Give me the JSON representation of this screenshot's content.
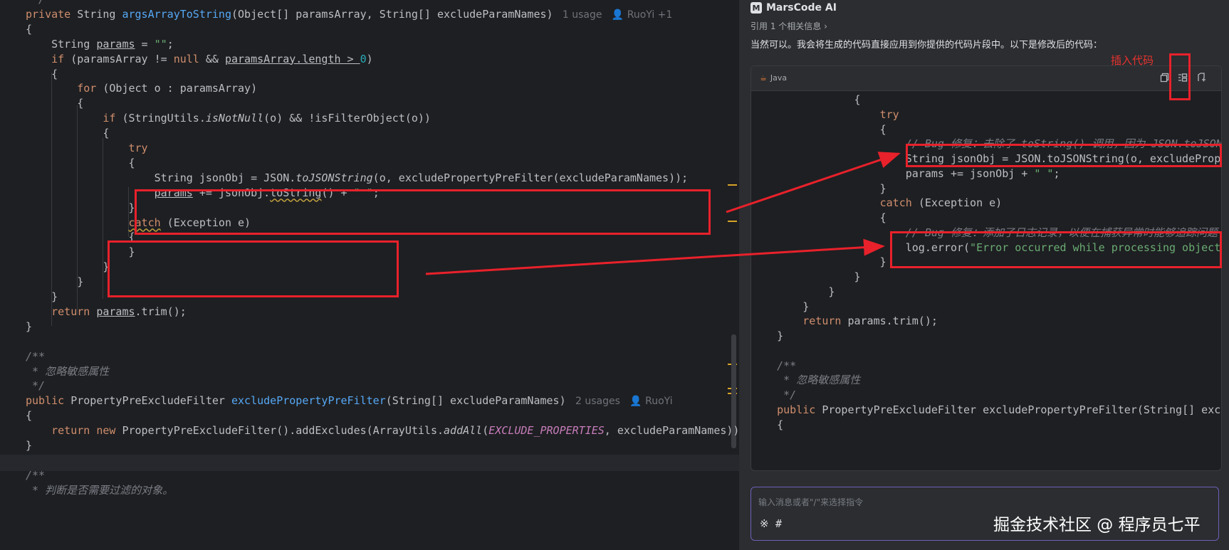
{
  "editor": {
    "lines": [
      {
        "t": "tail_comment",
        "parts": [
          [
            "cm",
            " */"
          ]
        ]
      },
      {
        "t": "sig1",
        "parts": [
          [
            "kw",
            "private "
          ],
          [
            "",
            "String "
          ],
          [
            "fn",
            "argsArrayToString"
          ],
          [
            "",
            "(Object[] paramsArray, String[] excludeParamNames)"
          ]
        ],
        "hint_usage": "1 usage",
        "hint_author": "RuoYi +1"
      },
      {
        "t": "b",
        "parts": [
          [
            "",
            "{"
          ]
        ]
      },
      {
        "t": "b",
        "parts": [
          [
            "",
            "    String "
          ],
          [
            "ul",
            "params"
          ],
          [
            "",
            " = "
          ],
          [
            "str",
            "\"\""
          ],
          [
            "",
            ";"
          ]
        ]
      },
      {
        "t": "b",
        "parts": [
          [
            "kw",
            "    if "
          ],
          [
            "",
            "(paramsArray != "
          ],
          [
            "kw",
            "null"
          ],
          [
            "",
            " && "
          ],
          [
            "ul",
            "paramsArray.length > "
          ],
          [
            "num",
            "0"
          ],
          [
            "",
            ")"
          ]
        ]
      },
      {
        "t": "b",
        "parts": [
          [
            "",
            "    {"
          ]
        ]
      },
      {
        "t": "b",
        "parts": [
          [
            "kw",
            "        for "
          ],
          [
            "",
            "(Object o : paramsArray)"
          ]
        ]
      },
      {
        "t": "b",
        "parts": [
          [
            "",
            "        {"
          ]
        ]
      },
      {
        "t": "b",
        "parts": [
          [
            "kw",
            "            if "
          ],
          [
            "",
            "(StringUtils."
          ],
          [
            "it",
            "isNotNull"
          ],
          [
            "",
            "(o) && !isFilterObject(o))"
          ]
        ]
      },
      {
        "t": "b",
        "parts": [
          [
            "",
            "            {"
          ]
        ]
      },
      {
        "t": "b",
        "parts": [
          [
            "kw",
            "                try"
          ]
        ]
      },
      {
        "t": "b",
        "parts": [
          [
            "",
            "                {"
          ]
        ]
      },
      {
        "t": "b",
        "parts": [
          [
            "",
            "                    String jsonObj = JSON."
          ],
          [
            "it",
            "toJSONString"
          ],
          [
            "",
            "(o, excludePropertyPreFilter(excludeParamNames));"
          ]
        ]
      },
      {
        "t": "b",
        "parts": [
          [
            "",
            "                    "
          ],
          [
            "ul",
            "params"
          ],
          [
            "",
            " += jsonObj."
          ],
          [
            "wavy",
            "toString"
          ],
          [
            "",
            "() + "
          ],
          [
            "str",
            "\" \""
          ],
          [
            "",
            ";"
          ]
        ]
      },
      {
        "t": "b",
        "parts": [
          [
            "",
            "                }"
          ]
        ]
      },
      {
        "t": "b",
        "parts": [
          [
            "",
            "                "
          ],
          [
            "kwwavy",
            "catch"
          ],
          [
            "",
            " (Exception e)"
          ]
        ]
      },
      {
        "t": "b",
        "parts": [
          [
            "",
            "                {"
          ]
        ]
      },
      {
        "t": "b",
        "parts": [
          [
            "",
            "                }"
          ]
        ]
      },
      {
        "t": "b",
        "parts": [
          [
            "",
            "            }"
          ]
        ]
      },
      {
        "t": "b",
        "parts": [
          [
            "",
            "        }"
          ]
        ]
      },
      {
        "t": "b",
        "parts": [
          [
            "",
            "    }"
          ]
        ]
      },
      {
        "t": "b",
        "parts": [
          [
            "kw",
            "    return "
          ],
          [
            "ul",
            "params"
          ],
          [
            "",
            ".trim();"
          ]
        ]
      },
      {
        "t": "b",
        "parts": [
          [
            "",
            "}"
          ]
        ]
      },
      {
        "t": "b",
        "parts": [
          [
            "",
            ""
          ]
        ]
      },
      {
        "t": "b",
        "parts": [
          [
            "cm",
            "/**"
          ]
        ]
      },
      {
        "t": "b",
        "parts": [
          [
            "cm",
            " * 忽略敏感属性"
          ]
        ]
      },
      {
        "t": "b",
        "parts": [
          [
            "cm",
            " */"
          ]
        ]
      },
      {
        "t": "sig2",
        "parts": [
          [
            "kw",
            "public "
          ],
          [
            "",
            "PropertyPreExcludeFilter "
          ],
          [
            "fn",
            "excludePropertyPreFilter"
          ],
          [
            "",
            "(String[] excludeParamNames)"
          ]
        ],
        "hint_usage": "2 usages",
        "hint_author": "RuoYi"
      },
      {
        "t": "b",
        "parts": [
          [
            "",
            "{"
          ]
        ]
      },
      {
        "t": "b",
        "parts": [
          [
            "kw",
            "    return new "
          ],
          [
            "",
            "PropertyPreExcludeFilter().addExcludes(ArrayUtils."
          ],
          [
            "it",
            "addAll"
          ],
          [
            "",
            "("
          ],
          [
            "const",
            "EXCLUDE_PROPERTIES"
          ],
          [
            "",
            ", excludeParamNames));"
          ]
        ]
      },
      {
        "t": "b",
        "parts": [
          [
            "",
            "}"
          ]
        ]
      },
      {
        "t": "b",
        "parts": [
          [
            "",
            ""
          ]
        ]
      },
      {
        "t": "b",
        "parts": [
          [
            "cm",
            "/**"
          ]
        ]
      },
      {
        "t": "b",
        "parts": [
          [
            "cm",
            " * 判断是否需要过滤的对象。"
          ]
        ]
      }
    ]
  },
  "panel": {
    "brand": "MarsCode AI",
    "reference": "引用 1 个相关信息 ›",
    "intro": "当然可以。我会将生成的代码直接应用到你提供的代码片段中。以下是修改后的代码：",
    "insert_note": "插入代码",
    "lang": "Java",
    "code_lines": [
      [
        [
          "",
          "                {"
        ]
      ],
      [
        [
          "kw",
          "                    try"
        ]
      ],
      [
        [
          "",
          "                    {"
        ]
      ],
      [
        [
          "cm",
          "                        // Bug 修复：去除了 toString() 调用，因为 JSON.toJSONString 已返回字符串"
        ]
      ],
      [
        [
          "",
          "                        String jsonObj = JSON.toJSONString(o, excludePropertyPreFilter(excludeParamNames));"
        ]
      ],
      [
        [
          "",
          "                        params += jsonObj + "
        ],
        [
          "str",
          "\" \""
        ],
        [
          "",
          ";"
        ]
      ],
      [
        [
          "",
          "                    }"
        ]
      ],
      [
        [
          "kw",
          "                    catch "
        ],
        [
          "",
          "(Exception e)"
        ]
      ],
      [
        [
          "",
          "                    {"
        ]
      ],
      [
        [
          "cm",
          "                        // Bug 修复：添加了日志记录，以便在捕获异常时能够追踪问题"
        ]
      ],
      [
        [
          "",
          "                        log.error("
        ],
        [
          "str",
          "\"Error occurred while processing object\""
        ],
        [
          "",
          ", e);"
        ]
      ],
      [
        [
          "",
          "                    }"
        ]
      ],
      [
        [
          "",
          "                }"
        ]
      ],
      [
        [
          "",
          "            }"
        ]
      ],
      [
        [
          "",
          "        }"
        ]
      ],
      [
        [
          "kw",
          "        return "
        ],
        [
          "",
          "params.trim();"
        ]
      ],
      [
        [
          "",
          "    }"
        ]
      ],
      [
        [
          "",
          ""
        ]
      ],
      [
        [
          "cm",
          "    /**"
        ]
      ],
      [
        [
          "cm",
          "     * 忽略敏感属性"
        ]
      ],
      [
        [
          "cm",
          "     */"
        ]
      ],
      [
        [
          "kw",
          "    public "
        ],
        [
          "",
          "PropertyPreExcludeFilter excludePropertyPreFilter(String[] excludeParamNames)"
        ]
      ],
      [
        [
          "",
          "    {"
        ]
      ]
    ],
    "input_placeholder": "输入消息或者\"/\"来选择指令",
    "input_icon_a": "※",
    "input_icon_b": "#",
    "watermark": "掘金技术社区 @ 程序员七平"
  },
  "colors": {
    "annotation_red": "#e8212b",
    "input_border": "#6f5fb8"
  }
}
